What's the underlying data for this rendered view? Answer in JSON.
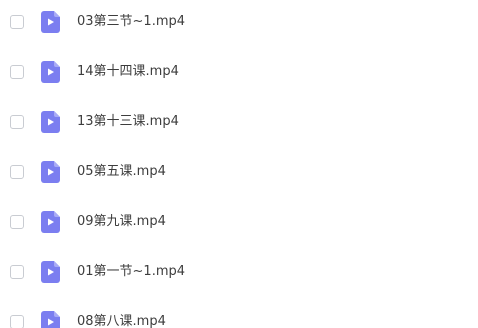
{
  "files": [
    {
      "name": "03第三节~1.mp4",
      "icon": "video-file-icon",
      "checked": false
    },
    {
      "name": "14第十四课.mp4",
      "icon": "video-file-icon",
      "checked": false
    },
    {
      "name": "13第十三课.mp4",
      "icon": "video-file-icon",
      "checked": false
    },
    {
      "name": "05第五课.mp4",
      "icon": "video-file-icon",
      "checked": false
    },
    {
      "name": "09第九课.mp4",
      "icon": "video-file-icon",
      "checked": false
    },
    {
      "name": "01第一节~1.mp4",
      "icon": "video-file-icon",
      "checked": false
    },
    {
      "name": "08第八课.mp4",
      "icon": "video-file-icon",
      "checked": false
    }
  ],
  "colors": {
    "icon_fill": "#7b7ef0",
    "icon_fold": "#a9abf6",
    "text": "#3d3d3d",
    "checkbox_border": "#c9ccd2"
  }
}
